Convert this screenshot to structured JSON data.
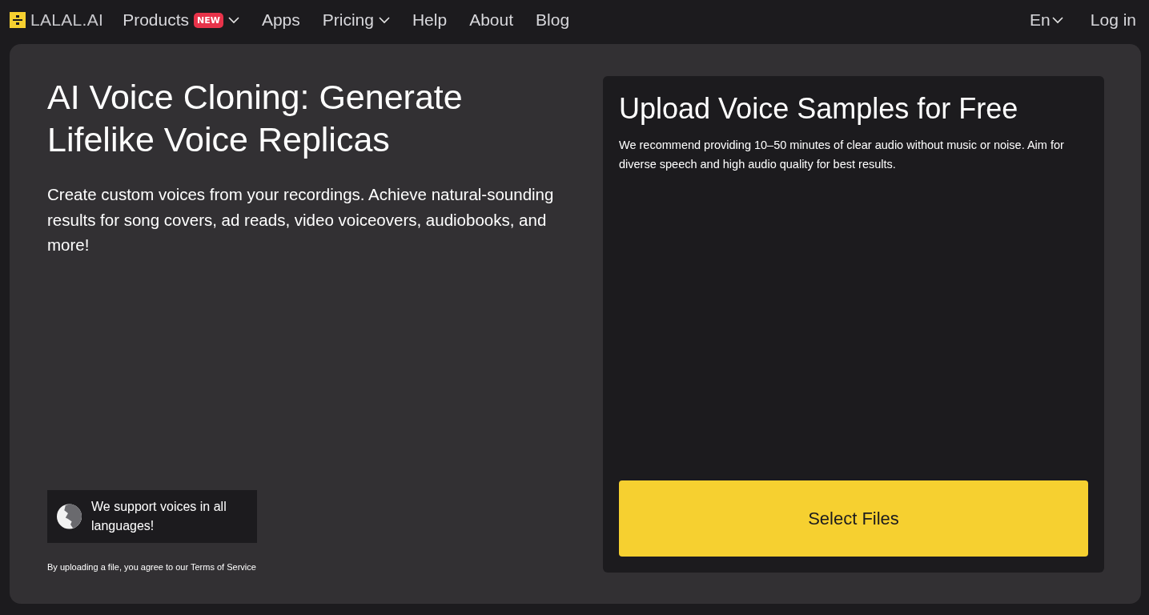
{
  "header": {
    "logo": "LALAL.AI",
    "nav": [
      {
        "label": "Products",
        "badge": "NEW",
        "dropdown": true
      },
      {
        "label": "Apps",
        "dropdown": false
      },
      {
        "label": "Pricing",
        "dropdown": true
      },
      {
        "label": "Help",
        "dropdown": false
      },
      {
        "label": "About",
        "dropdown": false
      },
      {
        "label": "Blog",
        "dropdown": false
      }
    ],
    "language": "En",
    "login": "Log in"
  },
  "hero": {
    "title": "AI Voice Cloning: Generate Lifelike Voice Replicas",
    "subtitle": "Create custom voices from your recordings. Achieve natural-sounding results for song covers, ad reads, video voiceovers, audiobooks, and more!",
    "languages_note": "We support voices in all languages!",
    "terms_text": "By uploading a file, you agree to our ",
    "terms_link": "Terms of Service"
  },
  "upload": {
    "title": "Upload Voice Samples for Free",
    "description": "We recommend providing 10–50 minutes of clear audio without music or noise. Aim for diverse speech and high audio quality for best results.",
    "button": "Select Files"
  }
}
